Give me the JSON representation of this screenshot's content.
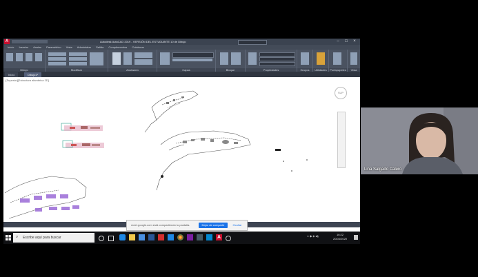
{
  "autocad": {
    "title": "Autodesk AutoCAD 2019 - VERSIÓN DEL ESTUDIANTE   10 de Dibujo",
    "ribbon_tabs": [
      "Inicio",
      "Insertar",
      "Anotar",
      "Paramétrico",
      "Vista",
      "Administrar",
      "Salida",
      "Complementos",
      "Colaborar"
    ],
    "ribbon_groups": [
      "Dibujo",
      "Modificar",
      "Anotación",
      "Capas",
      "Bloque",
      "Propiedades",
      "Grupos",
      "Utilidades",
      "Portapapeles",
      "Vista"
    ],
    "doc_tabs": [
      "Inicio",
      "Dibujo1*"
    ],
    "viewport_label": "-[Superior][Estructura alámbrica 2D]",
    "viewcube_label": "SUP"
  },
  "share_notification": {
    "message": "meet.google.com está compartiendo tu pantalla.",
    "stop_label": "Dejar de compartir",
    "hide_label": "Ocultar"
  },
  "taskbar": {
    "search_placeholder": "Escribe aquí para buscar",
    "clock_time": "16:22",
    "clock_date": "20/04/2020"
  },
  "participant": {
    "name": "Lina Salgado Calero"
  }
}
